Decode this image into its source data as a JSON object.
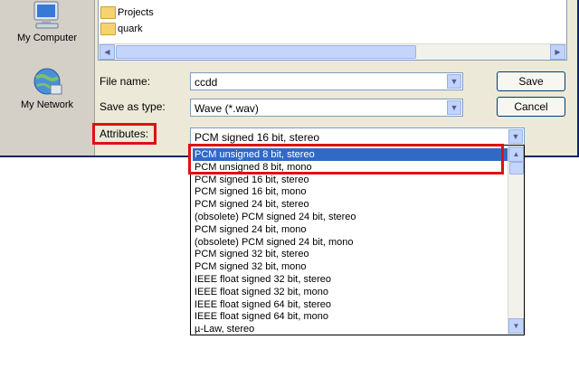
{
  "places": [
    {
      "label": "My Computer",
      "icon": "computer-icon"
    },
    {
      "label": "My Network",
      "icon": "network-icon"
    }
  ],
  "files": [
    {
      "name": "Projects",
      "icon": "folder-icon"
    },
    {
      "name": "quark",
      "icon": "folder-icon"
    }
  ],
  "form": {
    "filename_label": "File name:",
    "filename_value": "ccdd",
    "savetype_label": "Save as type:",
    "savetype_value": "Wave (*.wav)",
    "attributes_label": "Attributes:",
    "attributes_value": "PCM signed 16 bit, stereo"
  },
  "buttons": {
    "save": "Save",
    "cancel": "Cancel"
  },
  "options": [
    "PCM unsigned 8 bit, stereo",
    "PCM unsigned 8 bit, mono",
    "PCM signed 16 bit, stereo",
    "PCM signed 16 bit, mono",
    "PCM signed 24 bit, stereo",
    "(obsolete) PCM signed 24 bit, stereo",
    "PCM signed 24 bit, mono",
    "(obsolete) PCM signed 24 bit, mono",
    "PCM signed 32 bit, stereo",
    "PCM signed 32 bit, mono",
    "IEEE float signed 32 bit, stereo",
    "IEEE float signed 32 bit, mono",
    "IEEE float signed 64 bit, stereo",
    "IEEE float signed 64 bit, mono",
    "µ-Law, stereo"
  ],
  "selected_option_index": 0,
  "colors": {
    "highlight": "#316ac5",
    "annotation": "#e01010"
  }
}
